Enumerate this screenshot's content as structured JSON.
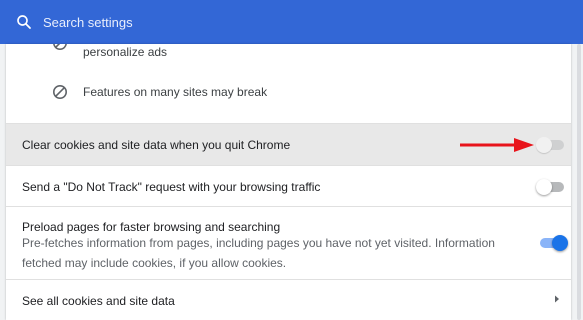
{
  "search": {
    "placeholder": "Search settings",
    "icon": "search-icon"
  },
  "sub_items": [
    {
      "icon": "blocked-icon",
      "text": "personalize ads"
    },
    {
      "icon": "blocked-icon",
      "text": "Features on many sites may break"
    }
  ],
  "settings": [
    {
      "title": "Clear cookies and site data when you quit Chrome",
      "toggle": "off",
      "highlighted": true
    },
    {
      "title": "Send a \"Do Not Track\" request with your browsing traffic",
      "toggle": "off"
    },
    {
      "title": "Preload pages for faster browsing and searching",
      "description": "Pre-fetches information from pages, including pages you have not yet visited. Information fetched may include cookies, if you allow cookies.",
      "toggle": "on"
    },
    {
      "title": "See all cookies and site data",
      "icon": "chevron-right-icon"
    }
  ],
  "annotation": {
    "icon": "red-arrow-icon",
    "color": "#e8141b"
  },
  "colors": {
    "header": "#3367d6",
    "toggle_on": "#1a73e8",
    "highlight_row": "#e8e8e8",
    "background": "#f1f3f4"
  }
}
